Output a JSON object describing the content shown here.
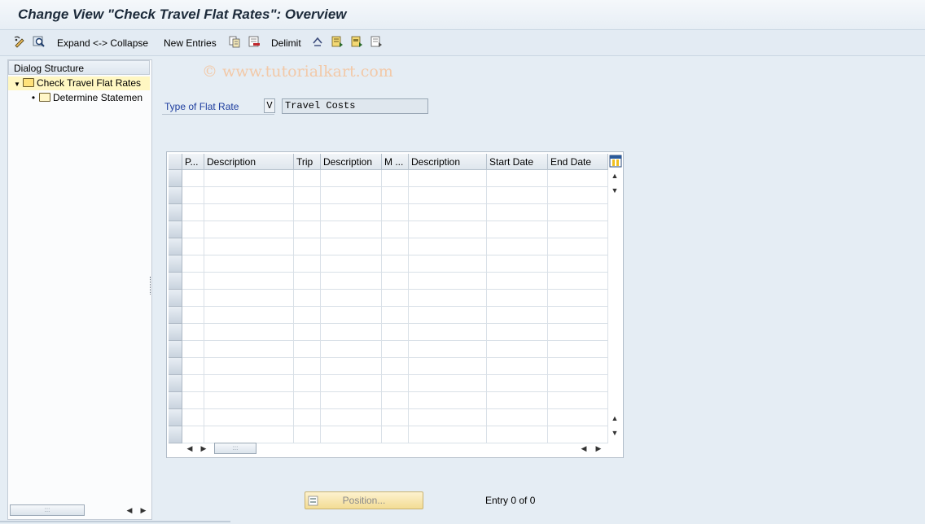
{
  "window": {
    "title": "Change View \"Check Travel Flat Rates\": Overview"
  },
  "toolbar": {
    "expand_collapse_label": "Expand <-> Collapse",
    "new_entries_label": "New Entries",
    "delimit_label": "Delimit"
  },
  "watermark": {
    "text": "© www.tutorialkart.com"
  },
  "dialog_structure": {
    "header": "Dialog Structure",
    "items": [
      {
        "label": "Check Travel Flat Rates",
        "selected": true,
        "expanded": true
      },
      {
        "label": "Determine Statemen"
      }
    ]
  },
  "form": {
    "type_of_flat_rate_label": "Type of Flat Rate",
    "type_of_flat_rate_value": "V",
    "type_of_flat_rate_desc": "Travel Costs"
  },
  "table": {
    "columns": [
      "P...",
      "Description",
      "Trip",
      "Description",
      "M ...",
      "Description",
      "Start Date",
      "End Date"
    ],
    "row_count": 16
  },
  "footer": {
    "position_button_label": "Position...",
    "entry_status": "Entry 0 of 0"
  },
  "colors": {
    "title": "#1c2a3a",
    "label_blue": "#1d3d9e",
    "selected_row": "#fff7c2",
    "button": "#f3dc94"
  }
}
